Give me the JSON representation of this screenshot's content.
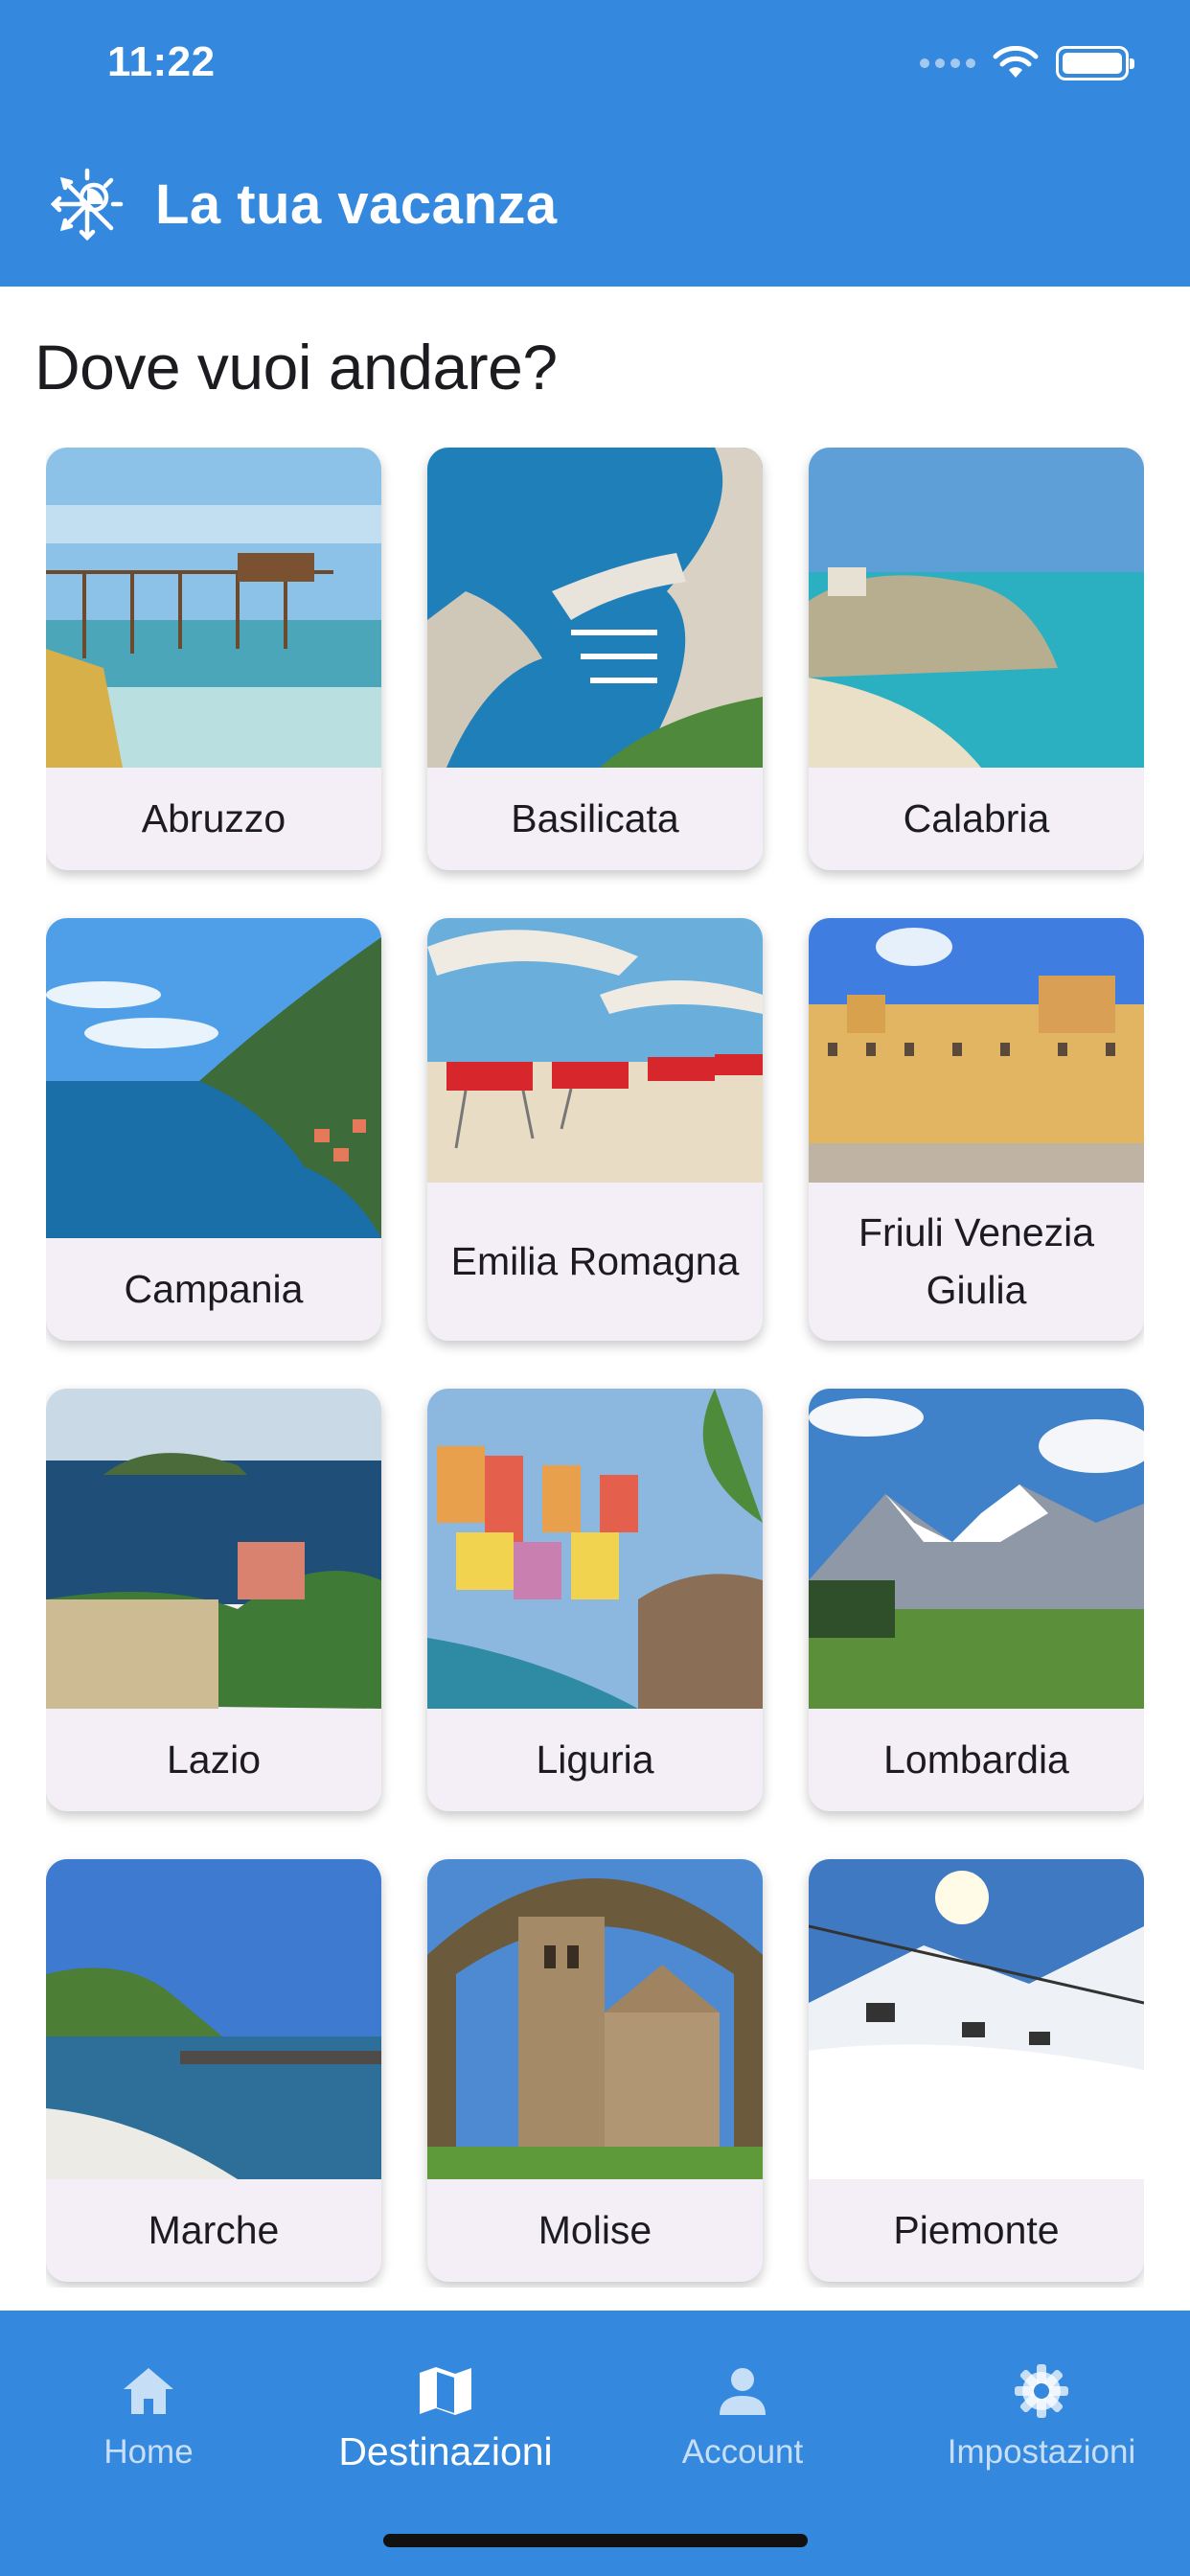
{
  "status_bar": {
    "time": "11:22"
  },
  "app": {
    "title": "La tua vacanza",
    "logo_icon": "sun-snowflake-icon"
  },
  "page": {
    "heading": "Dove vuoi andare?"
  },
  "regions": [
    {
      "name": "Abruzzo",
      "scene": "trabocco-beach"
    },
    {
      "name": "Basilicata",
      "scene": "harbor-aerial"
    },
    {
      "name": "Calabria",
      "scene": "cliff-beach"
    },
    {
      "name": "Campania",
      "scene": "coast-cliffs"
    },
    {
      "name": "Emilia Romagna",
      "scene": "beach-umbrellas"
    },
    {
      "name": "Friuli Venezia Giulia",
      "scene": "town-square"
    },
    {
      "name": "Lazio",
      "scene": "island-sea"
    },
    {
      "name": "Liguria",
      "scene": "colorful-village"
    },
    {
      "name": "Lombardia",
      "scene": "snowy-mountains"
    },
    {
      "name": "Marche",
      "scene": "rocky-shore"
    },
    {
      "name": "Molise",
      "scene": "stone-church"
    },
    {
      "name": "Piemonte",
      "scene": "ski-slope"
    }
  ],
  "nav": [
    {
      "label": "Home",
      "icon": "home-icon",
      "active": false
    },
    {
      "label": "Destinazioni",
      "icon": "map-icon",
      "active": true
    },
    {
      "label": "Account",
      "icon": "person-icon",
      "active": false
    },
    {
      "label": "Impostazioni",
      "icon": "gear-icon",
      "active": false
    }
  ],
  "colors": {
    "primary": "#3488de",
    "card_bg": "#f4eff7",
    "text": "#1c1b1f"
  }
}
